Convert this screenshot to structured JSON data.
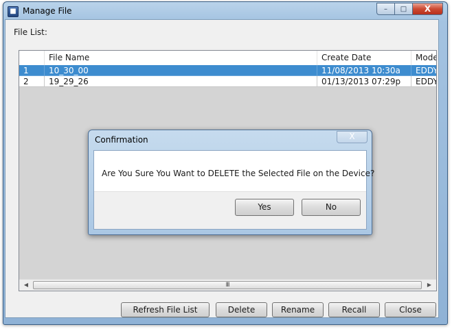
{
  "window": {
    "title": "Manage File",
    "caption_buttons": {
      "minimize": "–",
      "maximize": "□",
      "close": "X"
    }
  },
  "file_list_label": "File List:",
  "table": {
    "columns": [
      "",
      "File Name",
      "Create Date",
      "Mode"
    ],
    "rows": [
      {
        "index": "1",
        "file_name": "10_30_00",
        "create_date": "11/08/2013 10:30a",
        "mode": "EDDY",
        "selected": true
      },
      {
        "index": "2",
        "file_name": "19_29_26",
        "create_date": "01/13/2013 07:29p",
        "mode": "EDDY",
        "selected": false
      }
    ],
    "scrollbar_grip": "III"
  },
  "buttons": {
    "refresh": "Refresh File List",
    "delete": "Delete",
    "rename": "Rename",
    "recall": "Recall",
    "close": "Close"
  },
  "dialog": {
    "title": "Confirmation",
    "close_glyph": "X",
    "message": "Are You Sure You Want to DELETE the Selected File on the Device?",
    "yes": "Yes",
    "no": "No"
  },
  "colors": {
    "selection": "#3d8ccf",
    "title_bar": "#a4c3e1",
    "close_button": "#cc4a32"
  }
}
